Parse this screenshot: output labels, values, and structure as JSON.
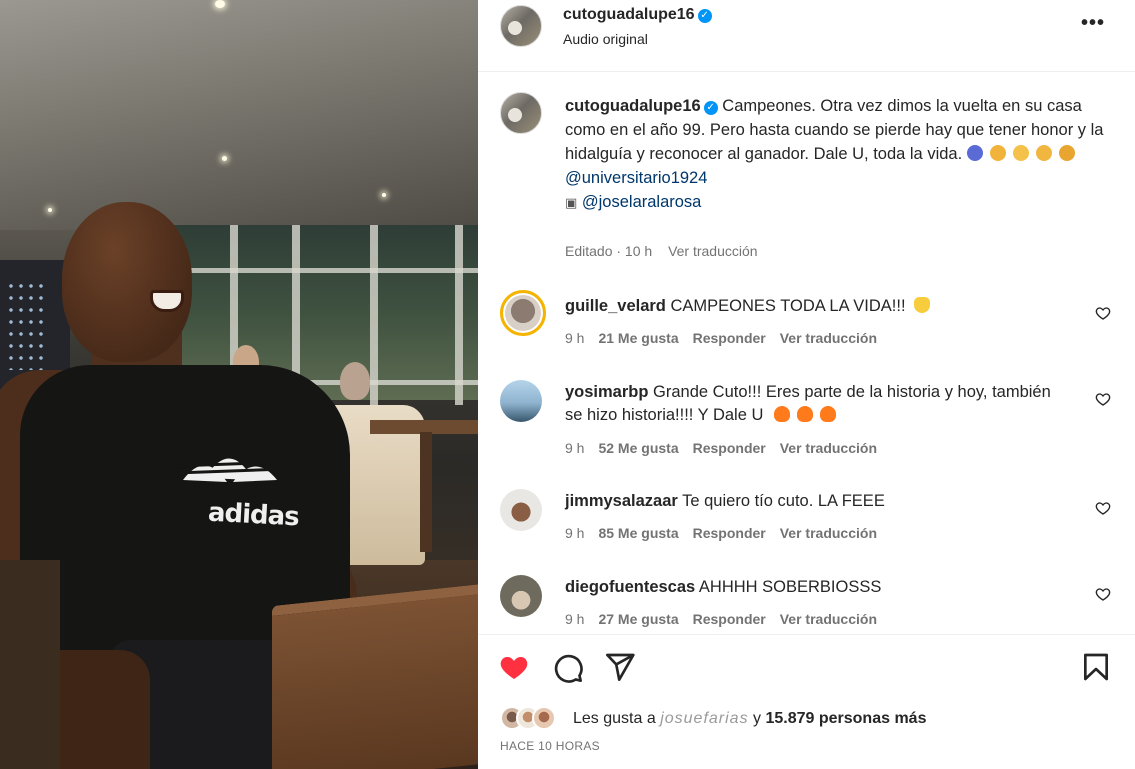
{
  "post": {
    "author": "cutoguadalupe16",
    "audio": "Audio original",
    "more_label": "•••",
    "caption_text": "Campeones. Otra vez dimos la vuelta en su casa como en el año 99. Pero hasta cuando se pierde hay que tener honor y la hidalguía y reconocer al ganador. Dale U, toda la vida.",
    "mention_1": "@universitario1924",
    "mention_2": "@joselaralarosa",
    "meta_edited": "Editado · 10 h",
    "meta_translate": "Ver traducción",
    "likes_prefix": "Les gusta a",
    "likes_obscured": "josuefarias",
    "likes_suffix_y": "y",
    "likes_count": "15.879 personas más",
    "time_ago": "HACE 10 HORAS"
  },
  "comments": [
    {
      "user": "guille_velard",
      "text": "CAMPEONES TODA LA VIDA!!!",
      "time": "9 h",
      "likes": "21 Me gusta",
      "reply": "Responder",
      "translate": "Ver traducción"
    },
    {
      "user": "yosimarbp",
      "text": "Grande Cuto!!! Eres parte de la historia y hoy, también se hizo historia!!!! Y Dale U",
      "time": "9 h",
      "likes": "52 Me gusta",
      "reply": "Responder",
      "translate": "Ver traducción"
    },
    {
      "user": "jimmysalazaar",
      "text": "Te quiero tío cuto. LA FEEE",
      "time": "9 h",
      "likes": "85 Me gusta",
      "reply": "Responder",
      "translate": "Ver traducción"
    },
    {
      "user": "diegofuentescas",
      "text": "AHHHH SOBERBIOSSS",
      "time": "9 h",
      "likes": "27 Me gusta",
      "reply": "Responder",
      "translate": "Ver traducción"
    }
  ],
  "video": {
    "shirt_brand": "adidas"
  },
  "colors": {
    "like_red": "#ff3040",
    "verified_blue": "#0095f6",
    "link_blue": "#00376b",
    "muted": "#737373"
  },
  "icons": [
    "verified-icon",
    "more-icon",
    "heart-filled-icon",
    "comment-icon",
    "share-icon",
    "bookmark-icon",
    "heart-outline-icon"
  ]
}
